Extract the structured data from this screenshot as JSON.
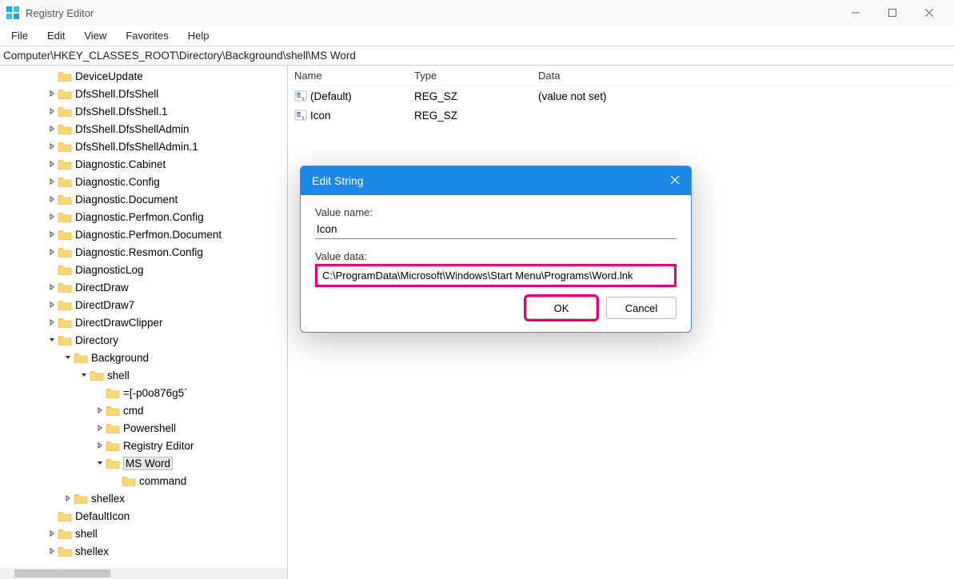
{
  "window": {
    "title": "Registry Editor"
  },
  "menu": {
    "file": "File",
    "edit": "Edit",
    "view": "View",
    "favorites": "Favorites",
    "help": "Help"
  },
  "address": "Computer\\HKEY_CLASSES_ROOT\\Directory\\Background\\shell\\MS Word",
  "tree": [
    {
      "label": "DeviceUpdate",
      "depth": 2,
      "caret": ""
    },
    {
      "label": "DfsShell.DfsShell",
      "depth": 2,
      "caret": ">"
    },
    {
      "label": "DfsShell.DfsShell.1",
      "depth": 2,
      "caret": ">"
    },
    {
      "label": "DfsShell.DfsShellAdmin",
      "depth": 2,
      "caret": ">"
    },
    {
      "label": "DfsShell.DfsShellAdmin.1",
      "depth": 2,
      "caret": ">"
    },
    {
      "label": "Diagnostic.Cabinet",
      "depth": 2,
      "caret": ">"
    },
    {
      "label": "Diagnostic.Config",
      "depth": 2,
      "caret": ">"
    },
    {
      "label": "Diagnostic.Document",
      "depth": 2,
      "caret": ">"
    },
    {
      "label": "Diagnostic.Perfmon.Config",
      "depth": 2,
      "caret": ">"
    },
    {
      "label": "Diagnostic.Perfmon.Document",
      "depth": 2,
      "caret": ">"
    },
    {
      "label": "Diagnostic.Resmon.Config",
      "depth": 2,
      "caret": ">"
    },
    {
      "label": "DiagnosticLog",
      "depth": 2,
      "caret": ""
    },
    {
      "label": "DirectDraw",
      "depth": 2,
      "caret": ">"
    },
    {
      "label": "DirectDraw7",
      "depth": 2,
      "caret": ">"
    },
    {
      "label": "DirectDrawClipper",
      "depth": 2,
      "caret": ">"
    },
    {
      "label": "Directory",
      "depth": 2,
      "caret": "v"
    },
    {
      "label": "Background",
      "depth": 3,
      "caret": "v"
    },
    {
      "label": "shell",
      "depth": 4,
      "caret": "v"
    },
    {
      "label": "=[-p0o876g5`",
      "depth": 5,
      "caret": ""
    },
    {
      "label": "cmd",
      "depth": 5,
      "caret": ">"
    },
    {
      "label": "Powershell",
      "depth": 5,
      "caret": ">"
    },
    {
      "label": "Registry Editor",
      "depth": 5,
      "caret": ">"
    },
    {
      "label": "MS Word",
      "depth": 5,
      "caret": "v",
      "selected": true
    },
    {
      "label": "command",
      "depth": 6,
      "caret": ""
    },
    {
      "label": "shellex",
      "depth": 3,
      "caret": ">"
    },
    {
      "label": "DefaultIcon",
      "depth": 2,
      "caret": ""
    },
    {
      "label": "shell",
      "depth": 2,
      "caret": ">"
    },
    {
      "label": "shellex",
      "depth": 2,
      "caret": ">"
    }
  ],
  "list": {
    "headers": {
      "name": "Name",
      "type": "Type",
      "data": "Data"
    },
    "rows": [
      {
        "name": "(Default)",
        "type": "REG_SZ",
        "data": "(value not set)"
      },
      {
        "name": "Icon",
        "type": "REG_SZ",
        "data": ""
      }
    ]
  },
  "dialog": {
    "title": "Edit String",
    "valueNameLabel": "Value name:",
    "valueName": "Icon",
    "valueDataLabel": "Value data:",
    "valueData": "C:\\ProgramData\\Microsoft\\Windows\\Start Menu\\Programs\\Word.lnk",
    "ok": "OK",
    "cancel": "Cancel"
  }
}
